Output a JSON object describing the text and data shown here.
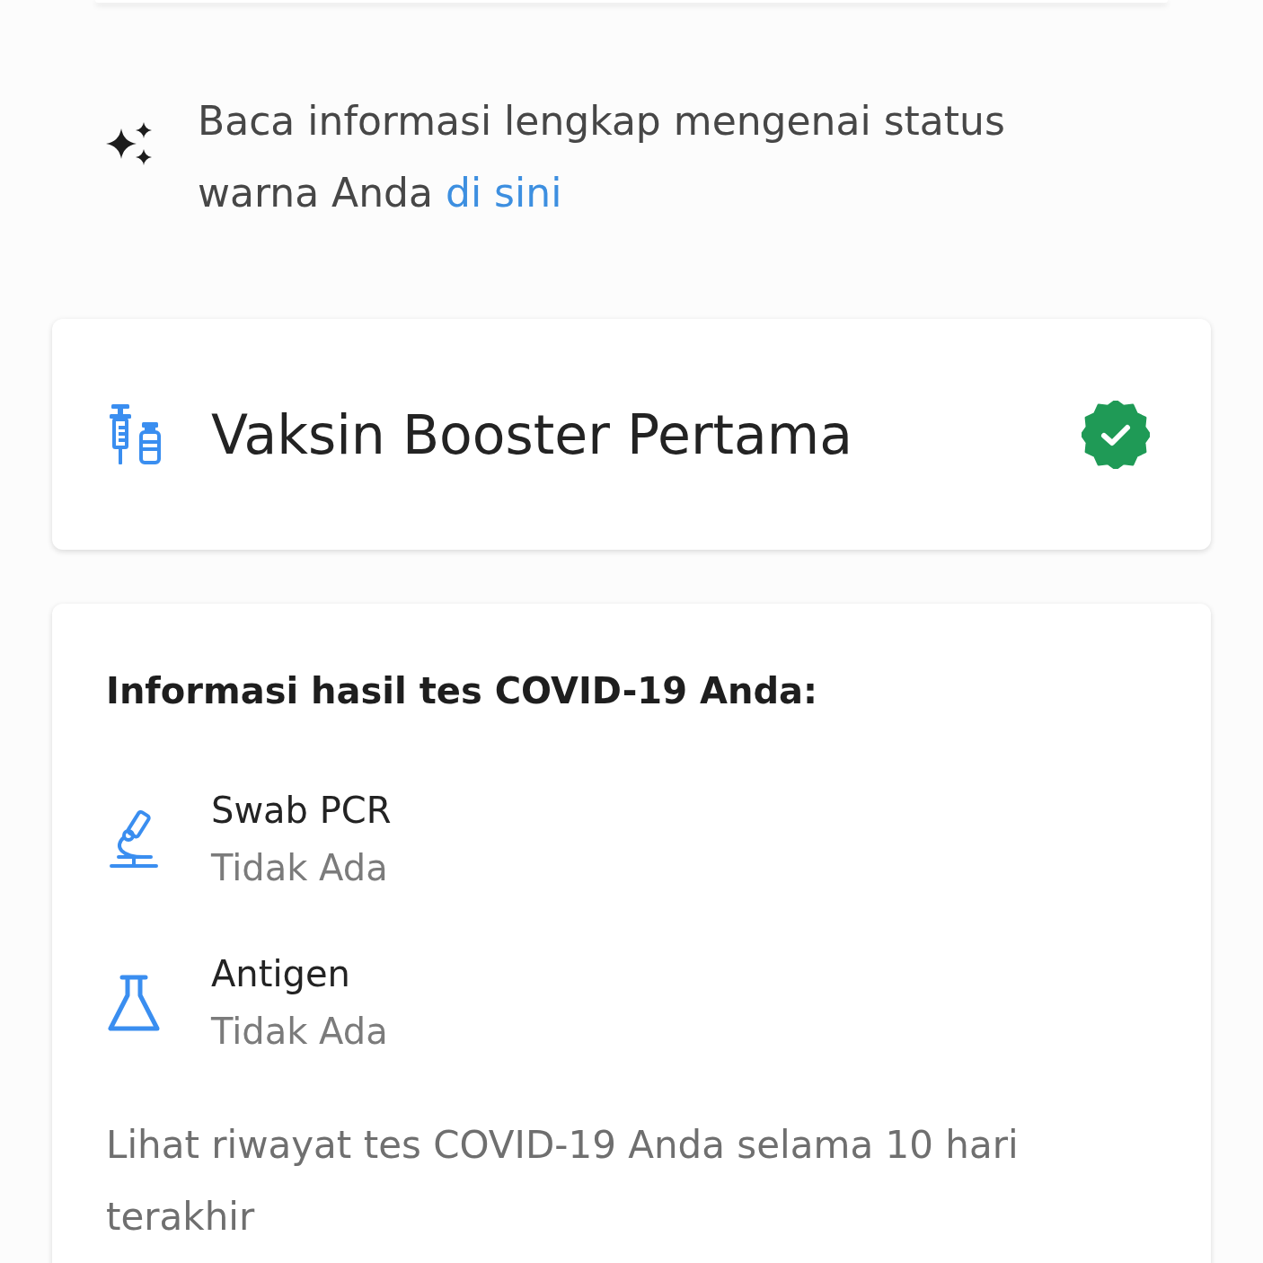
{
  "info": {
    "text": "Baca informasi lengkap mengenai status warna Anda",
    "link": "di sini"
  },
  "vaccine_card": {
    "title": "Vaksin Booster Pertama",
    "verified": true
  },
  "test_results": {
    "heading": "Informasi hasil tes COVID-19 Anda:",
    "items": [
      {
        "kind": "pcr",
        "label": "Swab PCR",
        "value": "Tidak Ada"
      },
      {
        "kind": "antigen",
        "label": "Antigen",
        "value": "Tidak Ada"
      }
    ],
    "history_text": "Lihat riwayat tes COVID-19 Anda selama 10 hari terakhir"
  }
}
